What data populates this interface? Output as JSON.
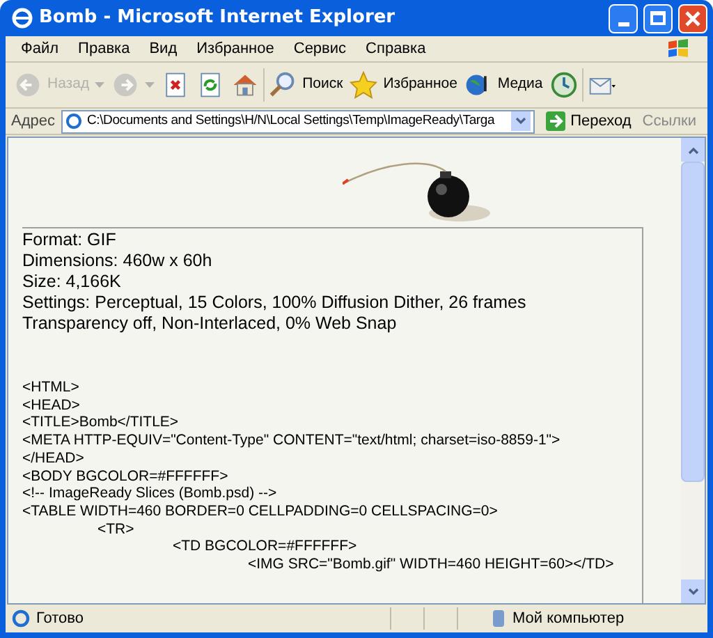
{
  "window": {
    "title": "Bomb - Microsoft Internet Explorer"
  },
  "menu": [
    "Файл",
    "Правка",
    "Вид",
    "Избранное",
    "Сервис",
    "Справка"
  ],
  "toolbar": [
    {
      "kind": "back",
      "label": "Назад",
      "disabled": true
    },
    {
      "kind": "forward",
      "disabled": true
    },
    {
      "kind": "stop"
    },
    {
      "kind": "refresh"
    },
    {
      "kind": "home"
    },
    {
      "kind": "search",
      "label": "Поиск"
    },
    {
      "kind": "favorites",
      "label": "Избранное"
    },
    {
      "kind": "media",
      "label": "Медиа"
    },
    {
      "kind": "history"
    },
    {
      "kind": "mail"
    }
  ],
  "address_bar": {
    "label": "Адрес",
    "value": "C:\\Documents and Settings\\H/N\\Local Settings\\Temp\\ImageReady\\Targa",
    "go": "Переход",
    "links": "Ссылки"
  },
  "info": [
    "Format: GIF",
    "Dimensions: 460w x 60h",
    "Size: 4,166K",
    "Settings: Perceptual, 15 Colors, 100% Diffusion Dither, 26 frames",
    "Transparency off, Non-Interlaced, 0% Web Snap"
  ],
  "code": [
    {
      "text": "<HTML>"
    },
    {
      "text": "<HEAD>"
    },
    {
      "text": "<TITLE>Bomb</TITLE>"
    },
    {
      "text": "<META HTTP-EQUIV=\"Content-Type\" CONTENT=\"text/html; charset=iso-8859-1\">"
    },
    {
      "text": "</HEAD>"
    },
    {
      "text": "<BODY BGCOLOR=#FFFFFF>"
    },
    {
      "text": "<!-- ImageReady Slices (Bomb.psd) -->"
    },
    {
      "text": "<TABLE WIDTH=460 BORDER=0 CELLPADDING=0 CELLSPACING=0>",
      "children": [
        {
          "text": "<TR>",
          "children": [
            {
              "text": "<TD BGCOLOR=#FFFFFF>",
              "children": [
                {
                  "text": "<IMG SRC=\"Bomb.gif\" WIDTH=460 HEIGHT=60></TD>"
                }
              ]
            }
          ]
        }
      ]
    }
  ],
  "status_bar": {
    "text": "Готово",
    "zone": "Мой компьютер"
  }
}
